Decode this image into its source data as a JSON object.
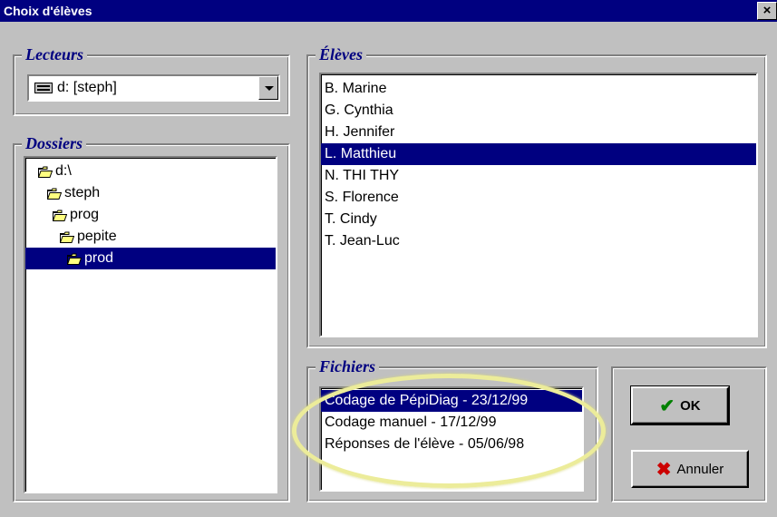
{
  "window": {
    "title": "Choix d'élèves",
    "close_glyph": "×"
  },
  "lecteurs": {
    "title": "Lecteurs",
    "selected_drive": "d: [steph]",
    "drive_icon": "drive-icon"
  },
  "dossiers": {
    "title": "Dossiers",
    "items": [
      {
        "label": "d:\\",
        "icon": "open-folder-icon"
      },
      {
        "label": "steph",
        "icon": "open-folder-icon"
      },
      {
        "label": "prog",
        "icon": "open-folder-icon"
      },
      {
        "label": "pepite",
        "icon": "open-folder-icon"
      },
      {
        "label": "prod",
        "icon": "open-folder-icon",
        "selected": true
      }
    ]
  },
  "eleves": {
    "title": "Élèves",
    "items": [
      {
        "label": "B. Marine"
      },
      {
        "label": "G. Cynthia"
      },
      {
        "label": "H. Jennifer"
      },
      {
        "label": "L. Matthieu",
        "selected": true
      },
      {
        "label": "N. THI THY"
      },
      {
        "label": "S. Florence"
      },
      {
        "label": "T. Cindy"
      },
      {
        "label": "T. Jean-Luc"
      }
    ]
  },
  "fichiers": {
    "title": "Fichiers",
    "items": [
      {
        "label": "Codage de PépiDiag - 23/12/99",
        "selected": true
      },
      {
        "label": "Codage manuel - 17/12/99"
      },
      {
        "label": "Réponses de l'élève - 05/06/98"
      }
    ]
  },
  "buttons": {
    "ok_label": "OK",
    "ok_icon": "checkmark-icon",
    "ok_icon_color": "#008000",
    "annuler_label": "Annuler",
    "annuler_icon": "x-icon",
    "annuler_icon_color": "#cc0000"
  },
  "colors": {
    "title_bar": "#000080",
    "selection": "#000080",
    "face": "#c0c0c0",
    "group_title": "#000080",
    "highlight_ellipse": "#ecec9a"
  }
}
